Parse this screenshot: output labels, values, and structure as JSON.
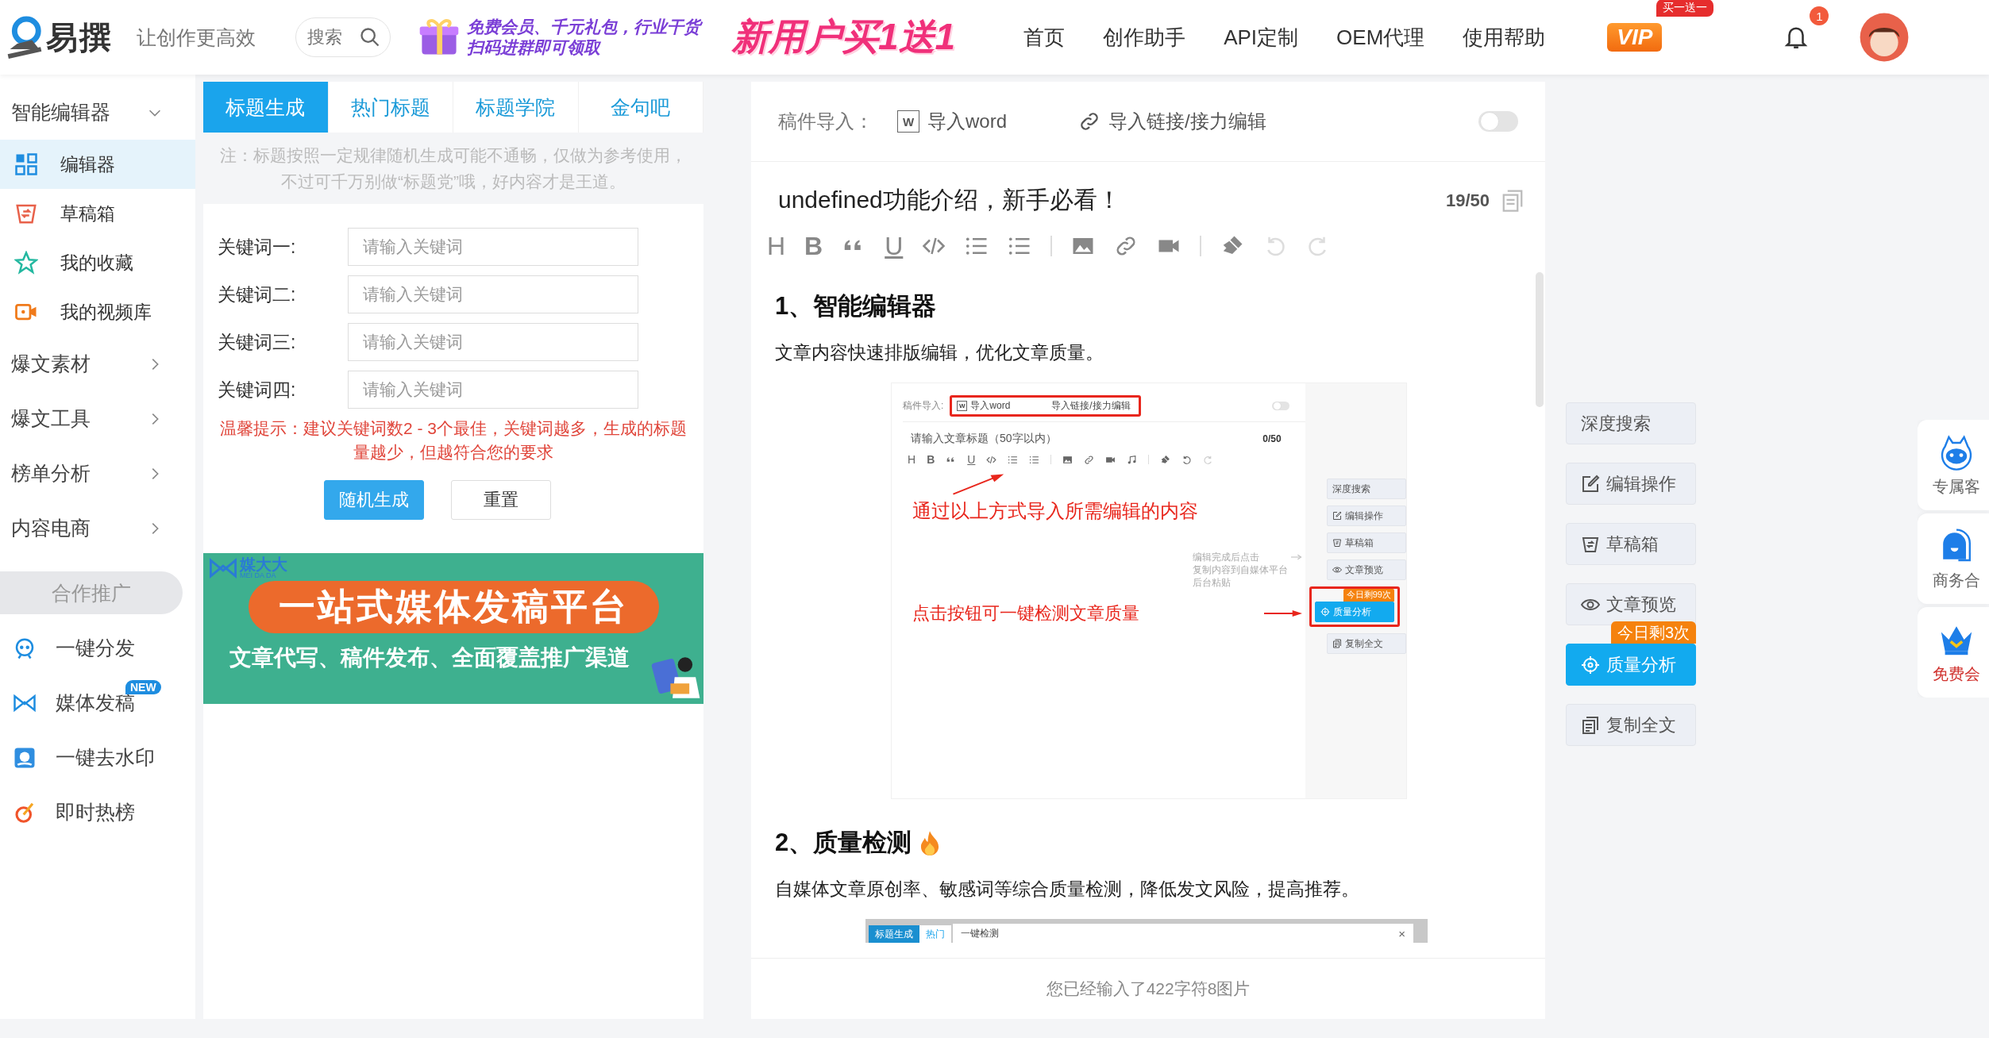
{
  "header": {
    "logo_text": "易撰",
    "slogan": "让创作更高效",
    "search": {
      "placeholder": "搜索"
    },
    "promo_lines": [
      "免费会员、千元礼包，行业干货",
      "扫码进群即可领取"
    ],
    "promo_sale": "新用户买1送1",
    "nav": [
      {
        "label": "首页"
      },
      {
        "label": "创作助手"
      },
      {
        "label": "API定制"
      },
      {
        "label": "OEM代理"
      },
      {
        "label": "使用帮助"
      }
    ],
    "vip_label": "VIP",
    "vip_badge": "买一送一",
    "notification_count": "1"
  },
  "sidebar": {
    "groups": [
      {
        "label": "智能编辑器",
        "expanded": true,
        "items": [
          {
            "label": "编辑器",
            "selected": true
          },
          {
            "label": "草稿箱",
            "selected": false
          },
          {
            "label": "我的收藏",
            "selected": false
          },
          {
            "label": "我的视频库",
            "selected": false
          }
        ]
      },
      {
        "label": "爆文素材",
        "expanded": false
      },
      {
        "label": "爆文工具",
        "expanded": false
      },
      {
        "label": "榜单分析",
        "expanded": false
      },
      {
        "label": "内容电商",
        "expanded": false
      }
    ],
    "promo_title": "合作推广",
    "promo_items": [
      {
        "label": "一键分发"
      },
      {
        "label": "媒体发稿",
        "badge": "NEW"
      },
      {
        "label": "一键去水印"
      },
      {
        "label": "即时热榜"
      }
    ]
  },
  "title_panel": {
    "tabs": [
      {
        "label": "标题生成",
        "selected": true
      },
      {
        "label": "热门标题",
        "selected": false
      },
      {
        "label": "标题学院",
        "selected": false
      },
      {
        "label": "金句吧",
        "selected": false
      }
    ],
    "note": "注：标题按照一定规律随机生成可能不通畅，仅做为参考使用，不过可千万别做“标题党”哦，好内容才是王道。",
    "fields": [
      {
        "label": "关键词一:",
        "placeholder": "请输入关键词"
      },
      {
        "label": "关键词二:",
        "placeholder": "请输入关键词"
      },
      {
        "label": "关键词三:",
        "placeholder": "请输入关键词"
      },
      {
        "label": "关键词四:",
        "placeholder": "请输入关键词"
      }
    ],
    "tip": "温馨提示：建议关键词数2 - 3个最佳，关键词越多，生成的标题量越少，但越符合您的要求",
    "buttons": [
      {
        "label": "随机生成",
        "kind": "primary"
      },
      {
        "label": "重置",
        "kind": "default"
      }
    ],
    "ad": {
      "brand": "媒大大",
      "brand_sub": "MEI DA DA",
      "headline": "一站式媒体发稿平台",
      "subline": "文章代写、稿件发布、全面覆盖推广渠道"
    }
  },
  "editor": {
    "import_label": "稿件导入：",
    "word_badge": "W",
    "import_word": "导入word",
    "import_link": "导入链接/接力编辑",
    "toggle_on": false,
    "title": "undefined功能介绍，新手必看！",
    "title_count": "19/50",
    "toolbar": [
      {
        "kind": "heading",
        "label": "H",
        "disabled": false
      },
      {
        "kind": "bold",
        "label": "B",
        "disabled": false
      },
      {
        "kind": "quote",
        "disabled": false
      },
      {
        "kind": "underline",
        "label": "U",
        "disabled": false
      },
      {
        "kind": "code",
        "disabled": false
      },
      {
        "kind": "ordered-list",
        "disabled": false
      },
      {
        "kind": "bullet-list",
        "disabled": false
      },
      {
        "kind": "divider"
      },
      {
        "kind": "image",
        "disabled": false
      },
      {
        "kind": "link",
        "disabled": false
      },
      {
        "kind": "video",
        "disabled": false
      },
      {
        "kind": "divider"
      },
      {
        "kind": "brush",
        "disabled": false
      },
      {
        "kind": "undo",
        "disabled": true
      },
      {
        "kind": "redo",
        "disabled": true
      }
    ],
    "content": [
      {
        "kind": "heading",
        "text": "1、智能编辑器",
        "fire": false
      },
      {
        "kind": "paragraph",
        "text": "文章内容快速排版编辑，优化文章质量。"
      },
      {
        "kind": "screenshot",
        "import_label": "稿件导入:",
        "word_badge": "W",
        "import_word": "导入word",
        "import_link": "导入链接/接力编辑",
        "toggle_on": false,
        "title_placeholder": "请输入文章标题（50字以内）",
        "title_count": "0/50",
        "toolbar": [
          {
            "kind": "heading",
            "label": "H",
            "disabled": false
          },
          {
            "kind": "bold",
            "label": "B",
            "disabled": false
          },
          {
            "kind": "quote",
            "disabled": false
          },
          {
            "kind": "underline",
            "label": "U",
            "disabled": false
          },
          {
            "kind": "code",
            "disabled": false
          },
          {
            "kind": "ordered-list",
            "disabled": false
          },
          {
            "kind": "bullet-list",
            "disabled": false
          },
          {
            "kind": "divider"
          },
          {
            "kind": "image",
            "disabled": false
          },
          {
            "kind": "link",
            "disabled": false
          },
          {
            "kind": "video",
            "disabled": false
          },
          {
            "kind": "music",
            "disabled": false
          },
          {
            "kind": "divider"
          },
          {
            "kind": "brush",
            "disabled": false
          },
          {
            "kind": "undo",
            "disabled": false
          },
          {
            "kind": "redo",
            "disabled": true
          }
        ],
        "callout_top": "通过以上方式导入所需编辑的内容",
        "hint_lines": [
          "编辑完成后点击",
          "复制内容到自媒体平台",
          "后台粘贴"
        ],
        "callout_bottom": "点击按钮可一键检测文章质量",
        "actions": [
          {
            "label": "深度搜索",
            "kind": "plain"
          },
          {
            "label": "编辑操作",
            "kind": "edit"
          },
          {
            "label": "草稿箱",
            "kind": "drafts"
          },
          {
            "label": "文章预览",
            "kind": "preview"
          },
          {
            "label": "质量分析",
            "kind": "primary",
            "badge": "今日剩99次"
          },
          {
            "label": "复制全文",
            "kind": "copy"
          }
        ]
      },
      {
        "kind": "heading",
        "text": "2、质量检测",
        "fire": true
      },
      {
        "kind": "paragraph",
        "text": "自媒体文章原创率、敏感词等综合质量检测，降低发文风险，提高推荐。"
      },
      {
        "kind": "screenshot_strip",
        "tabs": [
          {
            "label": "标题生成",
            "selected": true
          },
          {
            "label": "热门",
            "selected": false
          }
        ],
        "dialog_title": "一键检测",
        "close": "×"
      }
    ],
    "footer": "您已经输入了422字符8图片"
  },
  "actions": [
    {
      "label": "深度搜索",
      "kind": "plain"
    },
    {
      "label": "编辑操作",
      "kind": "edit"
    },
    {
      "label": "草稿箱",
      "kind": "drafts"
    },
    {
      "label": "文章预览",
      "kind": "preview"
    },
    {
      "label": "质量分析",
      "kind": "primary",
      "badge": "今日剩3次"
    },
    {
      "label": "复制全文",
      "kind": "copy"
    }
  ],
  "float_panel": [
    {
      "label": "专属客",
      "kind": "service"
    },
    {
      "label": "商务合",
      "kind": "business"
    },
    {
      "label": "免费会",
      "kind": "vip"
    }
  ]
}
